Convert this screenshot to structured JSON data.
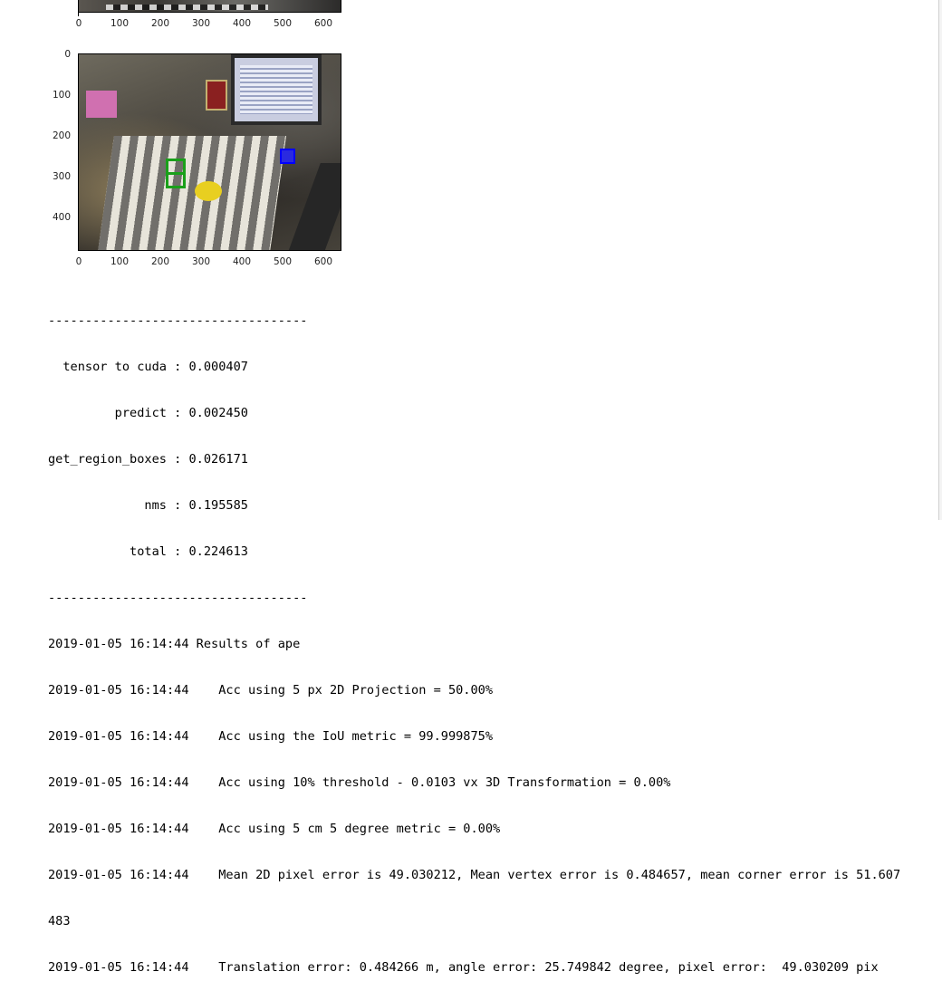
{
  "plots": {
    "top_plot": {
      "x_ticks": [
        "0",
        "100",
        "200",
        "300",
        "400",
        "500",
        "600"
      ]
    },
    "image_plot": {
      "x_ticks": [
        "0",
        "100",
        "200",
        "300",
        "400",
        "500",
        "600"
      ],
      "y_ticks": [
        "0",
        "100",
        "200",
        "300",
        "400"
      ]
    }
  },
  "console": {
    "lines": [
      "-----------------------------------",
      "  tensor to cuda : 0.000407",
      "         predict : 0.002450",
      "get_region_boxes : 0.026171",
      "             nms : 0.195585",
      "           total : 0.224613",
      "-----------------------------------",
      "2019-01-05 16:14:44 Results of ape",
      "2019-01-05 16:14:44    Acc using 5 px 2D Projection = 50.00%",
      "2019-01-05 16:14:44    Acc using the IoU metric = 99.999875%",
      "2019-01-05 16:14:44    Acc using 10% threshold - 0.0103 vx 3D Transformation = 0.00%",
      "2019-01-05 16:14:44    Acc using 5 cm 5 degree metric = 0.00%",
      "2019-01-05 16:14:44    Mean 2D pixel error is 49.030212, Mean vertex error is 0.484657, mean corner error is 51.607",
      "483",
      "2019-01-05 16:14:44    Translation error: 0.484266 m, angle error: 25.749842 degree, pixel error:  49.030209 pix"
    ]
  },
  "colors": {
    "detection_box_gt": "#1aa01a",
    "detection_box_pred": "#0000ff"
  }
}
